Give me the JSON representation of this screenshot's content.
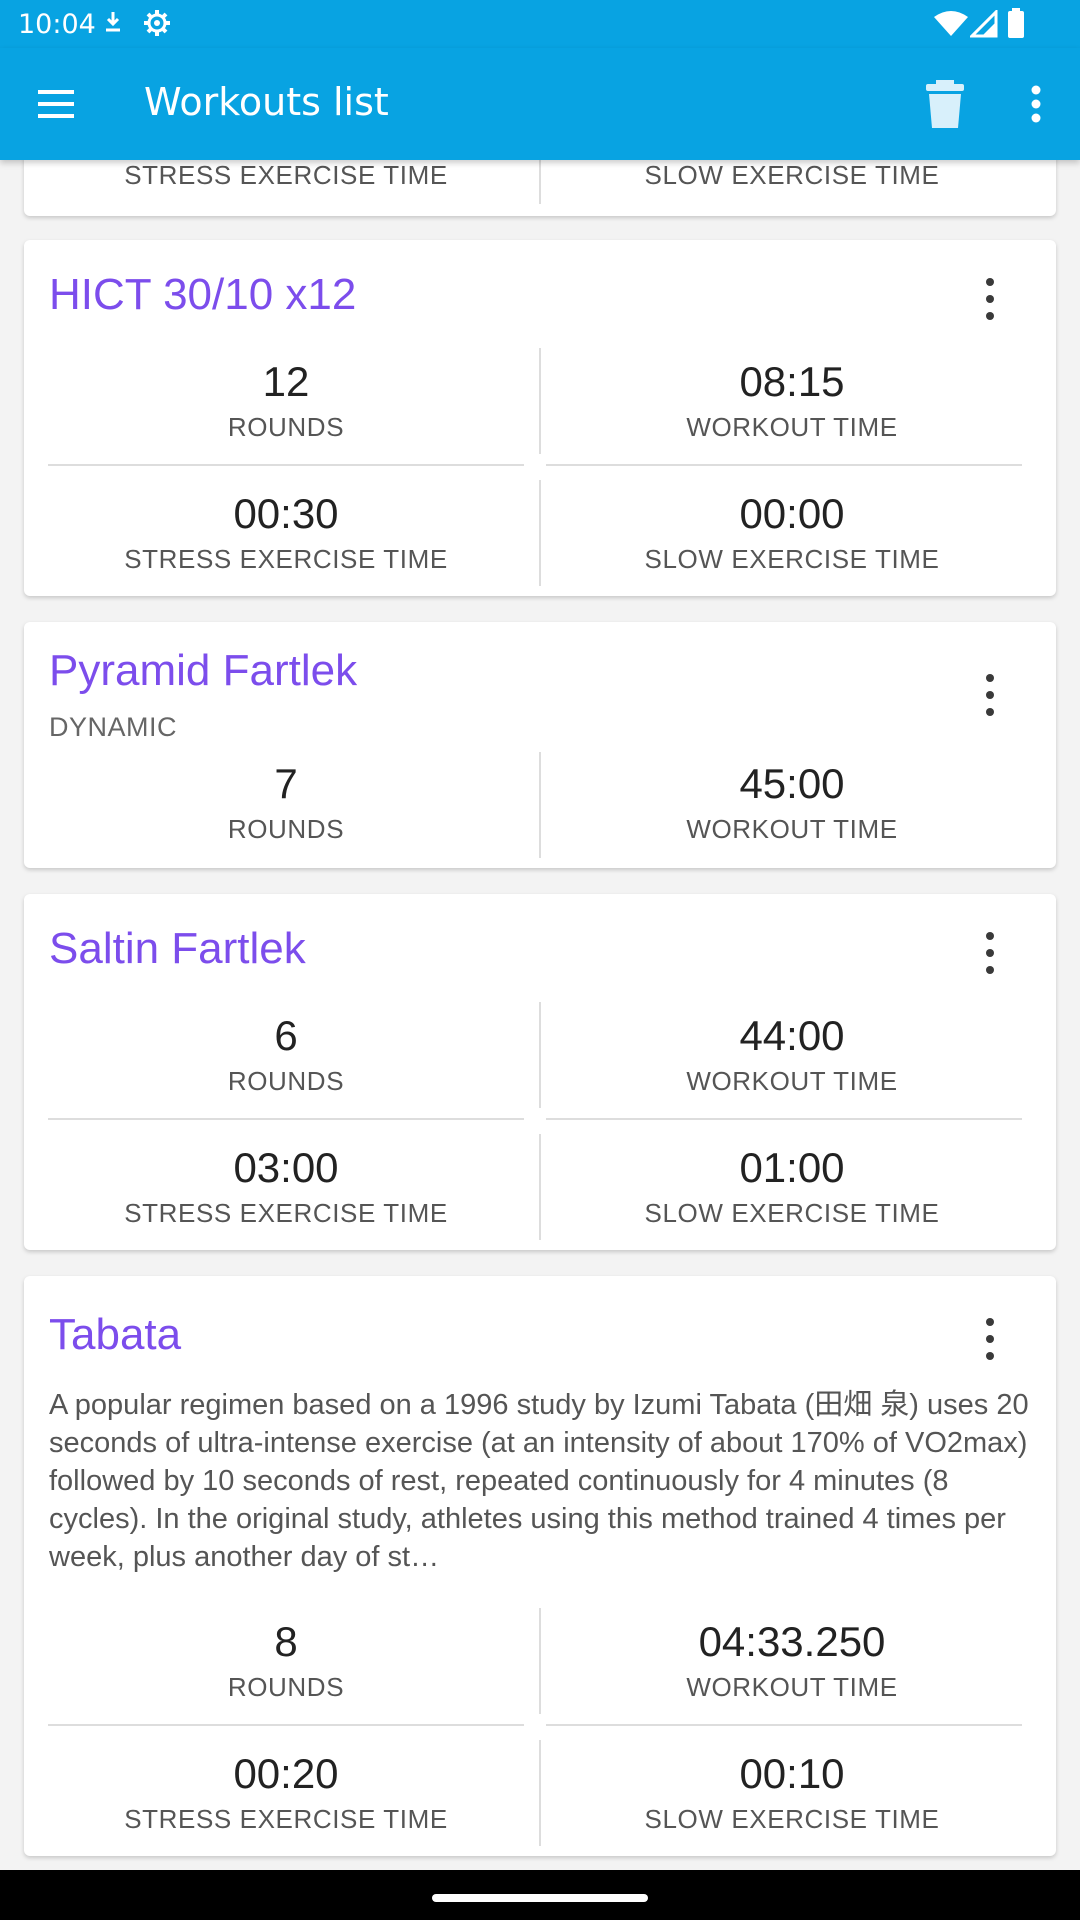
{
  "status_bar": {
    "time": "10:04",
    "icons": [
      "download-icon",
      "settings-gear-icon",
      "wifi-icon",
      "signal-icon",
      "battery-icon"
    ]
  },
  "app_bar": {
    "title": "Workouts list",
    "icons": [
      "menu-icon",
      "delete-icon",
      "more-vert-icon"
    ],
    "color": "#08a3e2"
  },
  "cards": [
    {
      "title": "",
      "stats": [
        {
          "value": "",
          "label": "STRESS EXERCISE TIME"
        },
        {
          "value": "",
          "label": "SLOW EXERCISE TIME"
        }
      ]
    },
    {
      "title": "HICT 30/10 x12",
      "stats": [
        {
          "value": "12",
          "label": "ROUNDS"
        },
        {
          "value": "08:15",
          "label": "WORKOUT TIME"
        },
        {
          "value": "00:30",
          "label": "STRESS EXERCISE TIME"
        },
        {
          "value": "00:00",
          "label": "SLOW EXERCISE TIME"
        }
      ]
    },
    {
      "title": "Pyramid Fartlek",
      "subtitle": "DYNAMIC",
      "stats": [
        {
          "value": "7",
          "label": "ROUNDS"
        },
        {
          "value": "45:00",
          "label": "WORKOUT TIME"
        }
      ]
    },
    {
      "title": "Saltin Fartlek",
      "stats": [
        {
          "value": "6",
          "label": "ROUNDS"
        },
        {
          "value": "44:00",
          "label": "WORKOUT TIME"
        },
        {
          "value": "03:00",
          "label": "STRESS EXERCISE TIME"
        },
        {
          "value": "01:00",
          "label": "SLOW EXERCISE TIME"
        }
      ]
    },
    {
      "title": "Tabata",
      "description": "  A popular regimen based on a 1996 study by Izumi Tabata (田畑 泉) uses 20 seconds of ultra-intense exercise (at an intensity of about 170% of VO2max) followed by 10 seconds of rest, repeated continuously for 4 minutes (8 cycles). In the original study, athletes using this method trained 4 times per week, plus another day of st…",
      "stats": [
        {
          "value": "8",
          "label": "ROUNDS"
        },
        {
          "value": "04:33.250",
          "label": "WORKOUT TIME"
        },
        {
          "value": "00:20",
          "label": "STRESS EXERCISE TIME"
        },
        {
          "value": "00:10",
          "label": "SLOW EXERCISE TIME"
        }
      ]
    }
  ],
  "colors": {
    "title_accent": "#7c4dec",
    "background": "#f3f3f3"
  }
}
